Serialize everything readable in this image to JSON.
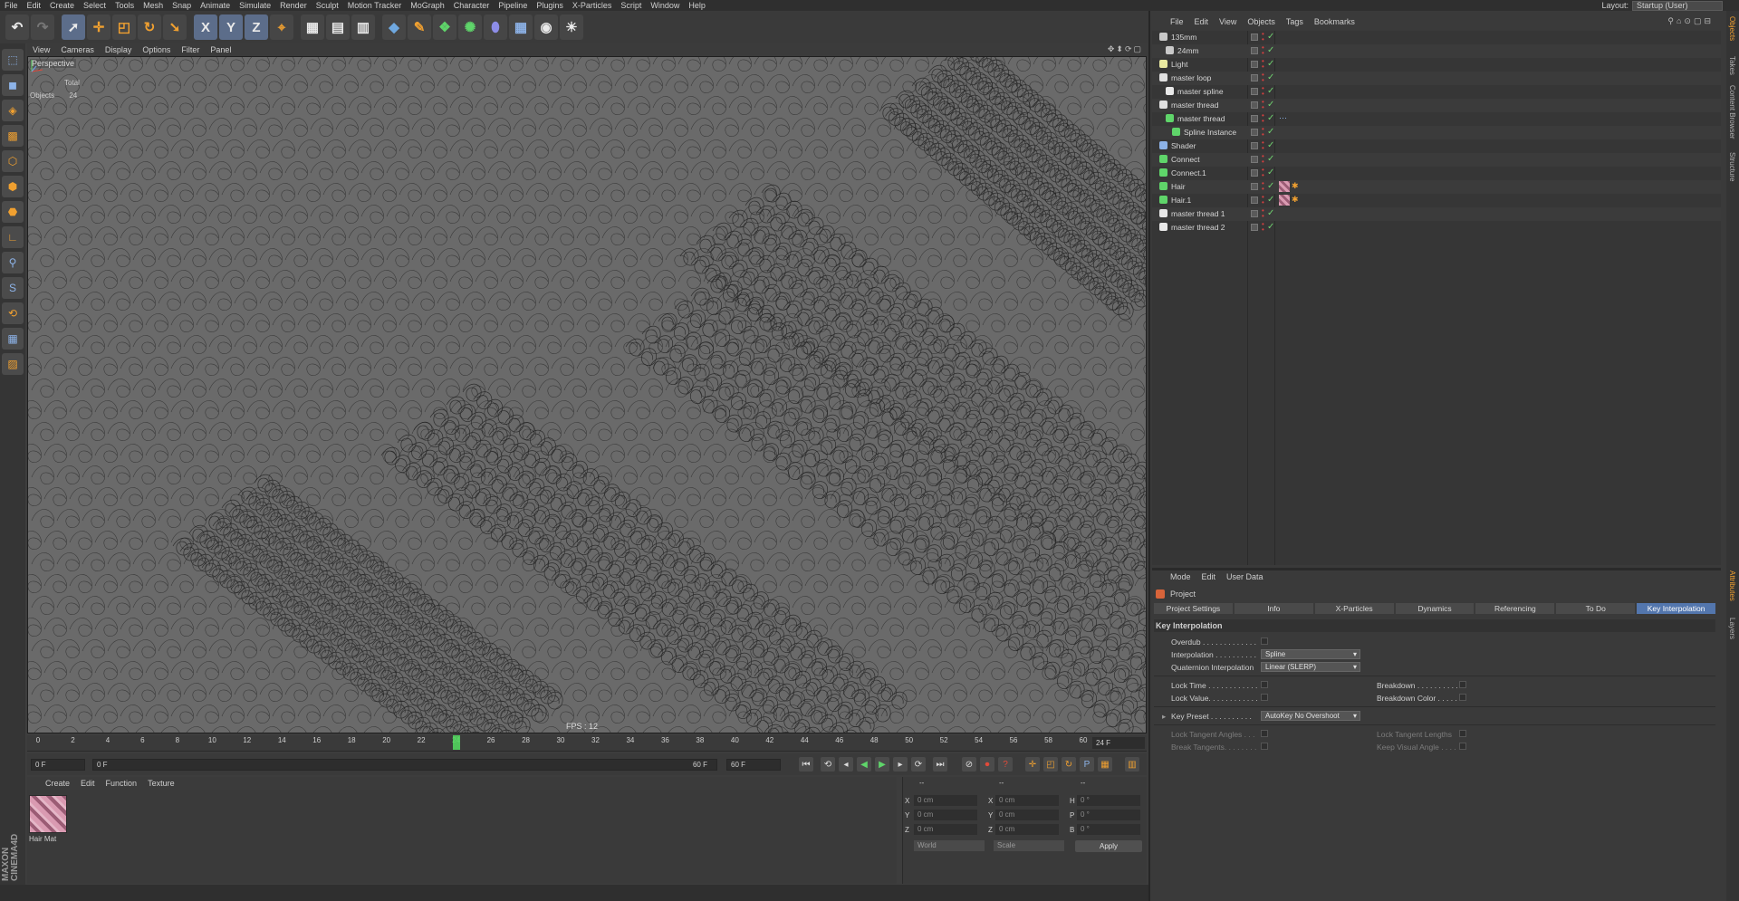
{
  "menubar": {
    "items": [
      "File",
      "Edit",
      "Create",
      "Select",
      "Tools",
      "Mesh",
      "Snap",
      "Animate",
      "Simulate",
      "Render",
      "Sculpt",
      "Motion Tracker",
      "MoGraph",
      "Character",
      "Pipeline",
      "Plugins",
      "X-Particles",
      "Script",
      "Window",
      "Help"
    ],
    "layout_label": "Layout:",
    "layout_value": "Startup (User)"
  },
  "toolbar": {
    "icons": [
      "undo-icon",
      "redo-icon",
      "select-icon",
      "move-icon",
      "scale-icon",
      "rotate-icon",
      "live-select-icon",
      "x-axis-icon",
      "y-axis-icon",
      "z-axis-icon",
      "world-coord-icon",
      "render-view-icon",
      "render-picture-viewer-icon",
      "edit-render-settings-icon",
      "cube-icon",
      "pen-spline-icon",
      "subdivision-icon",
      "array-icon",
      "deformer-icon",
      "floor-icon",
      "camera-icon",
      "light-icon"
    ],
    "axis_x": "X",
    "axis_y": "Y",
    "axis_z": "Z"
  },
  "viewport": {
    "menu": [
      "View",
      "Cameras",
      "Display",
      "Options",
      "Filter",
      "Panel"
    ],
    "label": "Perspective",
    "total_label": "Total",
    "objects_label": "Objects",
    "objects_value": "24",
    "fps": "FPS : 12"
  },
  "timeline": {
    "ticks": [
      0,
      2,
      4,
      6,
      8,
      10,
      12,
      14,
      16,
      18,
      20,
      22,
      24,
      26,
      28,
      30,
      32,
      34,
      36,
      38,
      40,
      42,
      44,
      46,
      48,
      50,
      52,
      54,
      56,
      58,
      60
    ],
    "current_frame": 24,
    "current_frame_text": "24 F"
  },
  "transport": {
    "start": "0 F",
    "range_start": "0 F",
    "range_end": "60 F",
    "end": "60 F"
  },
  "material_manager": {
    "menu": [
      "Create",
      "Edit",
      "Function",
      "Texture"
    ],
    "material_name": "Hair Mat"
  },
  "coordinates": {
    "headers": [
      "--",
      "--",
      "--"
    ],
    "rows": [
      {
        "axis": "X",
        "pos": "0 cm",
        "axis2": "X",
        "size": "0 cm",
        "rot_axis": "H",
        "rot": "0 °"
      },
      {
        "axis": "Y",
        "pos": "0 cm",
        "axis2": "Y",
        "size": "0 cm",
        "rot_axis": "P",
        "rot": "0 °"
      },
      {
        "axis": "Z",
        "pos": "0 cm",
        "axis2": "Z",
        "size": "0 cm",
        "rot_axis": "B",
        "rot": "0 °"
      }
    ],
    "mode1": "World",
    "mode2": "Scale",
    "apply": "Apply"
  },
  "object_manager": {
    "menu": [
      "File",
      "Edit",
      "View",
      "Objects",
      "Tags",
      "Bookmarks"
    ],
    "objects": [
      {
        "name": "135mm",
        "indent": 0,
        "icon": "camera-icon"
      },
      {
        "name": "24mm",
        "indent": 1,
        "icon": "camera-icon"
      },
      {
        "name": "Light",
        "indent": 0,
        "icon": "light-icon"
      },
      {
        "name": "master loop",
        "indent": 0,
        "icon": "null-icon"
      },
      {
        "name": "master spline",
        "indent": 1,
        "icon": "spline-icon"
      },
      {
        "name": "master thread",
        "indent": 0,
        "icon": "null-icon"
      },
      {
        "name": "master thread",
        "indent": 1,
        "icon": "sweep-icon"
      },
      {
        "name": "Spline Instance",
        "indent": 2,
        "icon": "spline-instance-icon"
      },
      {
        "name": "Shader",
        "indent": 0,
        "icon": "shader-icon"
      },
      {
        "name": "Connect",
        "indent": 0,
        "icon": "connect-icon"
      },
      {
        "name": "Connect.1",
        "indent": 0,
        "icon": "connect-icon"
      },
      {
        "name": "Hair",
        "indent": 0,
        "icon": "hair-icon"
      },
      {
        "name": "Hair.1",
        "indent": 0,
        "icon": "hair-icon"
      },
      {
        "name": "master thread 1",
        "indent": 0,
        "icon": "spline-icon"
      },
      {
        "name": "master thread 2",
        "indent": 0,
        "icon": "spline-icon"
      }
    ]
  },
  "attribute_manager": {
    "menu": [
      "Mode",
      "Edit",
      "User Data"
    ],
    "title": "Project",
    "tabs": [
      "Project Settings",
      "Info",
      "X-Particles",
      "Dynamics",
      "Referencing",
      "To Do",
      "Key Interpolation"
    ],
    "active_tab": "Key Interpolation",
    "section": "Key Interpolation",
    "overdub": "Overdub . . . . . . . . . . . . .",
    "interpolation_label": "Interpolation . . . . . . . . . .",
    "interpolation_value": "Spline",
    "quaternion_label": "Quaternion Interpolation",
    "quaternion_value": "Linear (SLERP)",
    "lock_time": "Lock Time . . . . . . . . . . . .",
    "lock_value": "Lock Value. . . . . . . . . . . .",
    "breakdown": "Breakdown . . . . . . . . . .",
    "breakdown_color": "Breakdown Color . . . . .",
    "key_preset_label": "Key Preset . . . . . . . . . .",
    "key_preset_value": "AutoKey No Overshoot",
    "lock_tangent_angles": "Lock Tangent Angles . . .",
    "break_tangents": "Break Tangents. . . . . . . .",
    "lock_tangent_lengths": "Lock Tangent Lengths",
    "keep_visual_angle": "Keep Visual Angle . . . ."
  },
  "right_strip": [
    "Objects",
    "Takes",
    "Content Browser",
    "Structure",
    "Attributes",
    "Layers"
  ],
  "brand": "MAXON CINEMA4D"
}
